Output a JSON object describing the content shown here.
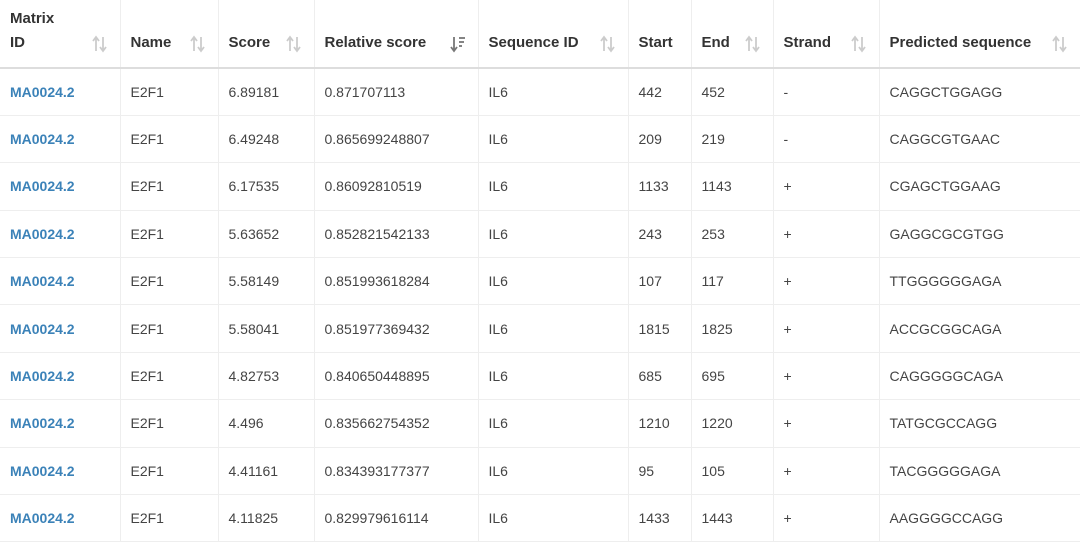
{
  "table": {
    "columns": [
      {
        "label": "Matrix ID",
        "sort": "unsorted"
      },
      {
        "label": "Name",
        "sort": "unsorted"
      },
      {
        "label": "Score",
        "sort": "unsorted"
      },
      {
        "label": "Relative score",
        "sort": "descending"
      },
      {
        "label": "Sequence ID",
        "sort": "unsorted"
      },
      {
        "label": "Start",
        "sort": "none"
      },
      {
        "label": "End",
        "sort": "unsorted"
      },
      {
        "label": "Strand",
        "sort": "unsorted"
      },
      {
        "label": "Predicted sequence",
        "sort": "unsorted"
      }
    ],
    "rows": [
      [
        "MA0024.2",
        "E2F1",
        "6.89181",
        "0.871707113",
        "IL6",
        "442",
        "452",
        "-",
        "CAGGCTGGAGG"
      ],
      [
        "MA0024.2",
        "E2F1",
        "6.49248",
        "0.865699248807",
        "IL6",
        "209",
        "219",
        "-",
        "CAGGCGTGAAC"
      ],
      [
        "MA0024.2",
        "E2F1",
        "6.17535",
        "0.86092810519",
        "IL6",
        "1133",
        "1143",
        "+",
        "CGAGCTGGAAG"
      ],
      [
        "MA0024.2",
        "E2F1",
        "5.63652",
        "0.852821542133",
        "IL6",
        "243",
        "253",
        "+",
        "GAGGCGCGTGG"
      ],
      [
        "MA0024.2",
        "E2F1",
        "5.58149",
        "0.851993618284",
        "IL6",
        "107",
        "117",
        "+",
        "TTGGGGGGAGA"
      ],
      [
        "MA0024.2",
        "E2F1",
        "5.58041",
        "0.851977369432",
        "IL6",
        "1815",
        "1825",
        "+",
        "ACCGCGGCAGA"
      ],
      [
        "MA0024.2",
        "E2F1",
        "4.82753",
        "0.840650448895",
        "IL6",
        "685",
        "695",
        "+",
        "CAGGGGGCAGA"
      ],
      [
        "MA0024.2",
        "E2F1",
        "4.496",
        "0.835662754352",
        "IL6",
        "1210",
        "1220",
        "+",
        "TATGCGCCAGG"
      ],
      [
        "MA0024.2",
        "E2F1",
        "4.41161",
        "0.834393177377",
        "IL6",
        "95",
        "105",
        "+",
        "TACGGGGGAGA"
      ],
      [
        "MA0024.2",
        "E2F1",
        "4.11825",
        "0.829979616114",
        "IL6",
        "1433",
        "1443",
        "+",
        "AAGGGGCCAGG"
      ]
    ]
  },
  "colors": {
    "link": "#3b82b8",
    "sort_icon_inactive": "#cccccc",
    "sort_icon_active": "#777777",
    "row_divider": "#eeeeee"
  },
  "icons": {
    "unsorted": "sort-both-icon",
    "descending": "sort-descending-icon"
  }
}
